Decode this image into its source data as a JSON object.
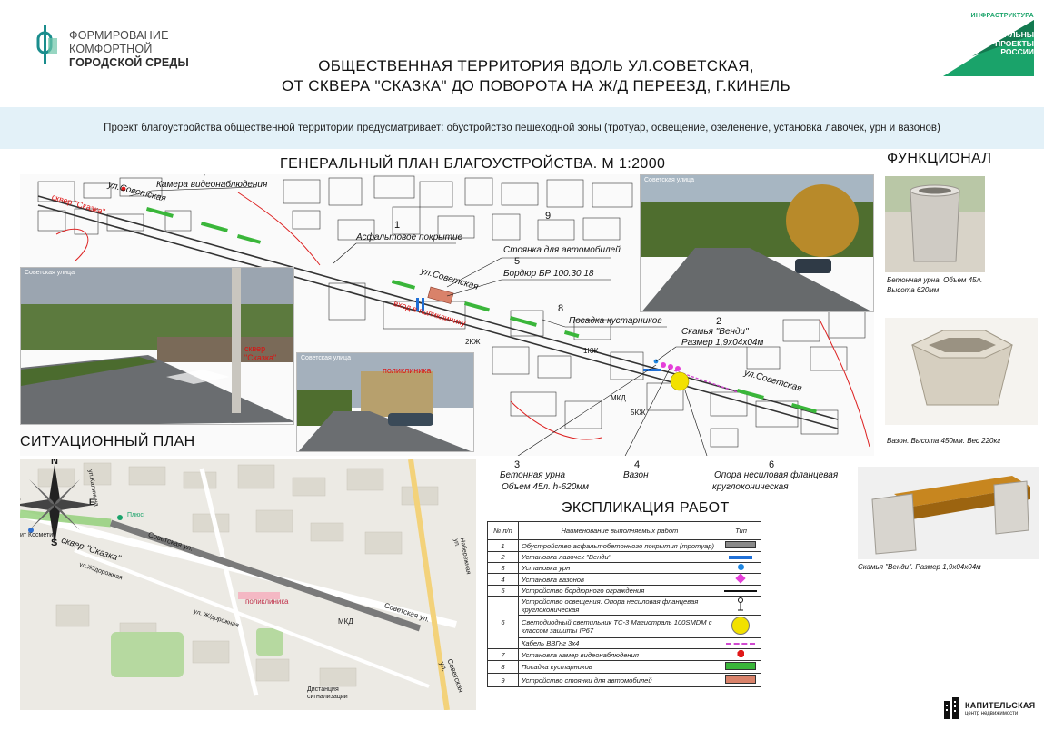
{
  "header": {
    "logo_left_lines": [
      "ФОРМИРОВАНИЕ",
      "КОМФОРТНОЙ",
      "ГОРОДСКОЙ СРЕДЫ"
    ],
    "title_line1": "ОБЩЕСТВЕННАЯ ТЕРРИТОРИЯ ВДОЛЬ УЛ.СОВЕТСКАЯ,",
    "title_line2": "ОТ СКВЕРА \"СКАЗКА\" ДО ПОВОРОТА НА Ж/Д ПЕРЕЕЗД, Г.КИНЕЛЬ",
    "logo_right_small": "ИНФРАСТРУКТУРА",
    "logo_right_big": [
      "НАЦИОНАЛЬНЫЕ",
      "ПРОЕКТЫ",
      "РОССИИ"
    ]
  },
  "banner": {
    "text": "Проект благоустройства общественной территории предусматривает: обустройство пешеходной зоны (тротуар, освещение, озеленение, установка лавочек, урн и вазонов)"
  },
  "general_plan": {
    "title": "ГЕНЕРАЛЬНЫЙ ПЛАН БЛАГОУСТРОЙСТВА. М 1:2000",
    "street_labels": [
      "ул.Советская",
      "ул.Советская",
      "ул.Советская"
    ],
    "red_labels": {
      "skver": "сквер \"Сказка\"",
      "entrance": "вход в поликлинику",
      "polyclinic": "поликлиника",
      "skver_photo": "сквер \"Сказка\""
    },
    "photo_labels": [
      "Советская улица",
      "Советская улица",
      "Советская улица"
    ],
    "callouts": [
      {
        "num": "7",
        "text": "Камера видеонаблюдения"
      },
      {
        "num": "1",
        "text": "Асфальтовое покрытие"
      },
      {
        "num": "9",
        "text": "Стоянка для автомобилей"
      },
      {
        "num": "5",
        "text": "Бордюр БР 100.30.18"
      },
      {
        "num": "8",
        "text": "Посадка кустарников"
      },
      {
        "num": "2",
        "text": "Скамья \"Венди\""
      },
      {
        "num": "",
        "text": "Размер 1,9х04х04м"
      },
      {
        "num": "3",
        "text": "Бетонная урна"
      },
      {
        "num": "",
        "text": "Объем 45л. h-620мм"
      },
      {
        "num": "4",
        "text": "Вазон"
      },
      {
        "num": "6",
        "text": "Опора несиловая фланцевая"
      },
      {
        "num": "",
        "text": "круглоконическая"
      }
    ],
    "map_small_labels": [
      "МКД",
      "5КЖ",
      "2КЖ",
      "1КЖ"
    ]
  },
  "situation_plan": {
    "title": "СИТУАЦИОННЫЙ ПЛАН",
    "labels": {
      "skver": "сквер \"Сказка\"",
      "sovetskaya1": "Советская ул.",
      "sovetskaya2": "Советская ул.",
      "sovetskaya3": "Советская ул.",
      "polyclinic": "поликлиника",
      "mkd": "МКД",
      "zhd": "ул.Ж/дорожная",
      "zhd2": "ул. Ж/дорожная",
      "cosmetic": "ит Косметик",
      "signal": "Дистанция сигнализации",
      "plus": "Плюс",
      "kalinina": "ул.Калинина",
      "naberezh": "Набережная ул."
    },
    "compass": {
      "n": "N",
      "s": "S",
      "e": "E",
      "w": "W"
    }
  },
  "explication": {
    "title": "ЭКСПЛИКАЦИЯ РАБОТ",
    "headers": {
      "num": "№ п/п",
      "name": "Наименование выполняемых работ",
      "type": "Тип"
    },
    "rows": [
      {
        "num": "1",
        "name": "Обустройство асфальтобетонного покрытия (тротуар)",
        "swatch": "asphalt"
      },
      {
        "num": "2",
        "name": "Установка лавочек \"Венди\"",
        "swatch": "bench"
      },
      {
        "num": "3",
        "name": "Установка урн",
        "swatch": "urn"
      },
      {
        "num": "4",
        "name": "Установка вазонов",
        "swatch": "vase"
      },
      {
        "num": "5",
        "name": "Устройство бордюрного ограждения",
        "swatch": "curb"
      },
      {
        "num": "6",
        "name": "Устройство освещения. Опора несиловая фланцевая круглоконическая",
        "swatch": "pole"
      },
      {
        "num": "",
        "name": "Светодиодный светильник ТС-3 Магистраль 100SMDM с классом защиты IP67",
        "swatch": "lamp"
      },
      {
        "num": "",
        "name": "Кабель ВВГнг 3х4",
        "swatch": "cable"
      },
      {
        "num": "7",
        "name": "Установка камер видеонаблюдения",
        "swatch": "camera"
      },
      {
        "num": "8",
        "name": "Посадка кустарников",
        "swatch": "shrub"
      },
      {
        "num": "9",
        "name": "Устройство стоянки для автомобилей",
        "swatch": "parking"
      }
    ]
  },
  "functional": {
    "title": "ФУНКЦИОНАЛ",
    "items": [
      {
        "caption1": "Бетонная урна. Объем 45л.",
        "caption2": "Высота 620мм"
      },
      {
        "caption1": "Вазон. Высота 450мм. Вес 220кг",
        "caption2": ""
      },
      {
        "caption1": "Скамья \"Венди\". Размер 1,9х04х04м",
        "caption2": ""
      }
    ]
  },
  "footer": {
    "brand": "КАПИТЕЛЬСКАЯ",
    "brand_sub": "центр недвижимости"
  },
  "colors": {
    "asphalt": "#8a8a8a",
    "bench": "#1f6fd6",
    "urn": "#1f86e0",
    "vase": "#e53fd9",
    "curb": "#111111",
    "lamp": "#f2e100",
    "cable": "#d04ad0",
    "camera": "#e01818",
    "shrub": "#3ab63a",
    "parking": "#d9826a",
    "brand_green": "#1aa36a",
    "brand_teal": "#1a8d8d",
    "banner_bg": "#e3f1f8"
  }
}
